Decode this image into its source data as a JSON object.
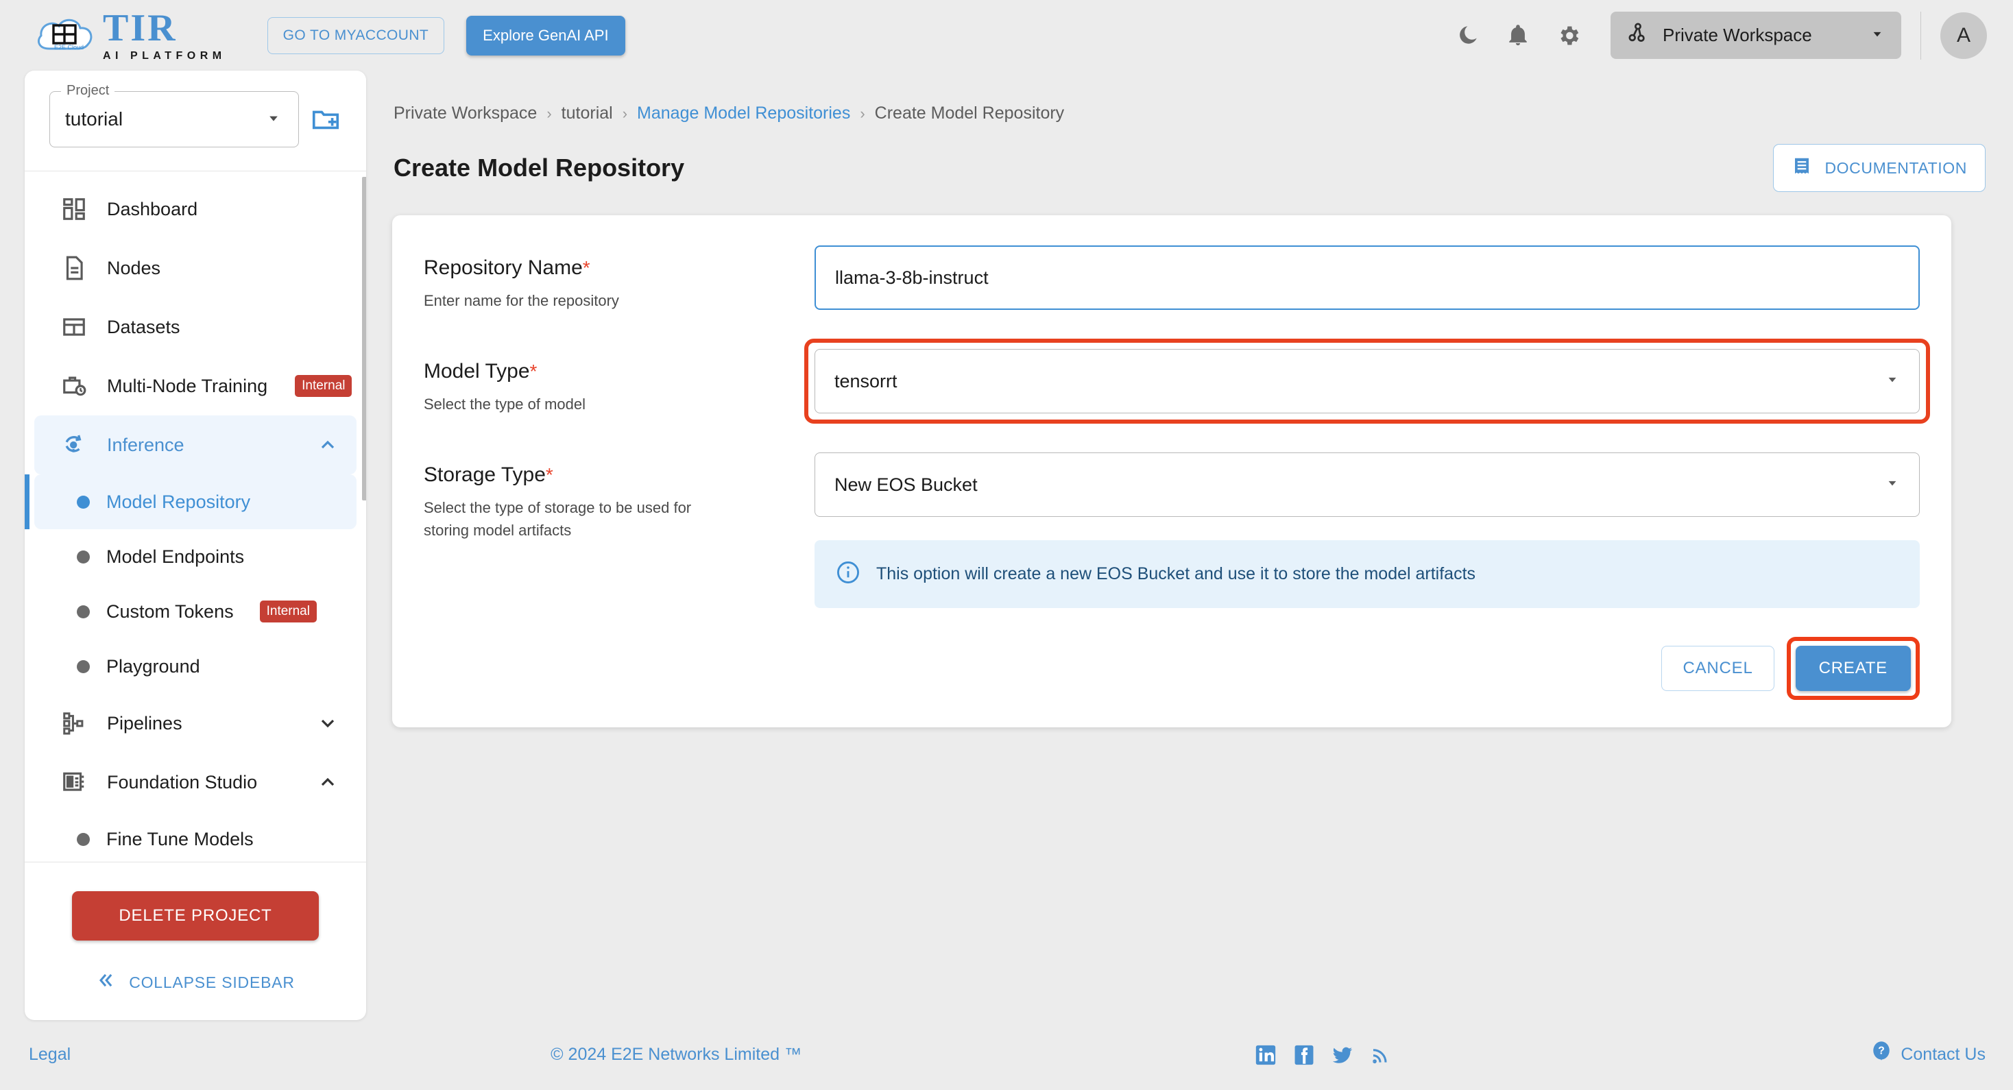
{
  "header": {
    "logo_title": "TIR",
    "logo_subtitle": "AI PLATFORM",
    "logo_cloud_text": "E2E Cloud",
    "myaccount_label": "GO TO MYACCOUNT",
    "genai_label": "Explore GenAI API",
    "workspace_label": "Private Workspace",
    "avatar_initial": "A",
    "icons": [
      "dark-mode-icon",
      "notifications-icon",
      "settings-icon"
    ]
  },
  "sidebar": {
    "project_legend": "Project",
    "project_value": "tutorial",
    "new_project_icon": "new-folder-icon",
    "items": [
      {
        "label": "Dashboard",
        "icon": "dashboard-icon",
        "type": "item"
      },
      {
        "label": "Nodes",
        "icon": "document-icon",
        "type": "item"
      },
      {
        "label": "Datasets",
        "icon": "table-icon",
        "type": "item"
      },
      {
        "label": "Multi-Node Training",
        "icon": "briefcase-clock-icon",
        "type": "item",
        "badge": "Internal"
      },
      {
        "label": "Inference",
        "icon": "inference-icon",
        "type": "group",
        "expanded": true,
        "active": true
      },
      {
        "label": "Model Repository",
        "type": "sub",
        "selected": true
      },
      {
        "label": "Model Endpoints",
        "type": "sub"
      },
      {
        "label": "Custom Tokens",
        "type": "sub",
        "badge": "Internal"
      },
      {
        "label": "Playground",
        "type": "sub"
      },
      {
        "label": "Pipelines",
        "icon": "pipelines-icon",
        "type": "group",
        "expanded": false
      },
      {
        "label": "Foundation Studio",
        "icon": "studio-icon",
        "type": "group",
        "expanded": true
      },
      {
        "label": "Fine Tune Models",
        "type": "sub"
      }
    ],
    "delete_project_label": "DELETE PROJECT",
    "collapse_label": "COLLAPSE SIDEBAR"
  },
  "main": {
    "breadcrumb": [
      {
        "label": "Private Workspace",
        "link": false
      },
      {
        "label": "tutorial",
        "link": false
      },
      {
        "label": "Manage Model Repositories",
        "link": true
      },
      {
        "label": "Create Model Repository",
        "link": false
      }
    ],
    "breadcrumb_separator": "›",
    "page_title": "Create Model Repository",
    "documentation_label": "DOCUMENTATION",
    "fields": [
      {
        "label": "Repository Name",
        "required_marker": "*",
        "description": "Enter name for the repository",
        "control": "text",
        "value": "llama-3-8b-instruct",
        "placeholder": ""
      },
      {
        "label": "Model Type",
        "required_marker": "*",
        "description": "Select the type of model",
        "control": "select",
        "value": "tensorrt",
        "highlighted": true
      },
      {
        "label": "Storage Type",
        "required_marker": "*",
        "description": "Select the type of storage to be used for storing model artifacts",
        "control": "select",
        "value": "New EOS Bucket"
      }
    ],
    "info_text": "This option will create a new EOS Bucket and use it to store the model artifacts",
    "info_icon": "info-icon",
    "cancel_label": "CANCEL",
    "create_label": "CREATE"
  },
  "footer": {
    "legal": "Legal",
    "copyright": "© 2024 E2E Networks Limited ™",
    "contact": "Contact Us",
    "social": [
      "linkedin-icon",
      "facebook-icon",
      "twitter-icon",
      "rss-icon"
    ]
  },
  "colors": {
    "accent_blue": "#4a90d0",
    "danger_red": "#c53f34",
    "highlight_orange": "#e8411f",
    "info_bg": "#e6f2fb",
    "page_bg": "#ececec"
  }
}
